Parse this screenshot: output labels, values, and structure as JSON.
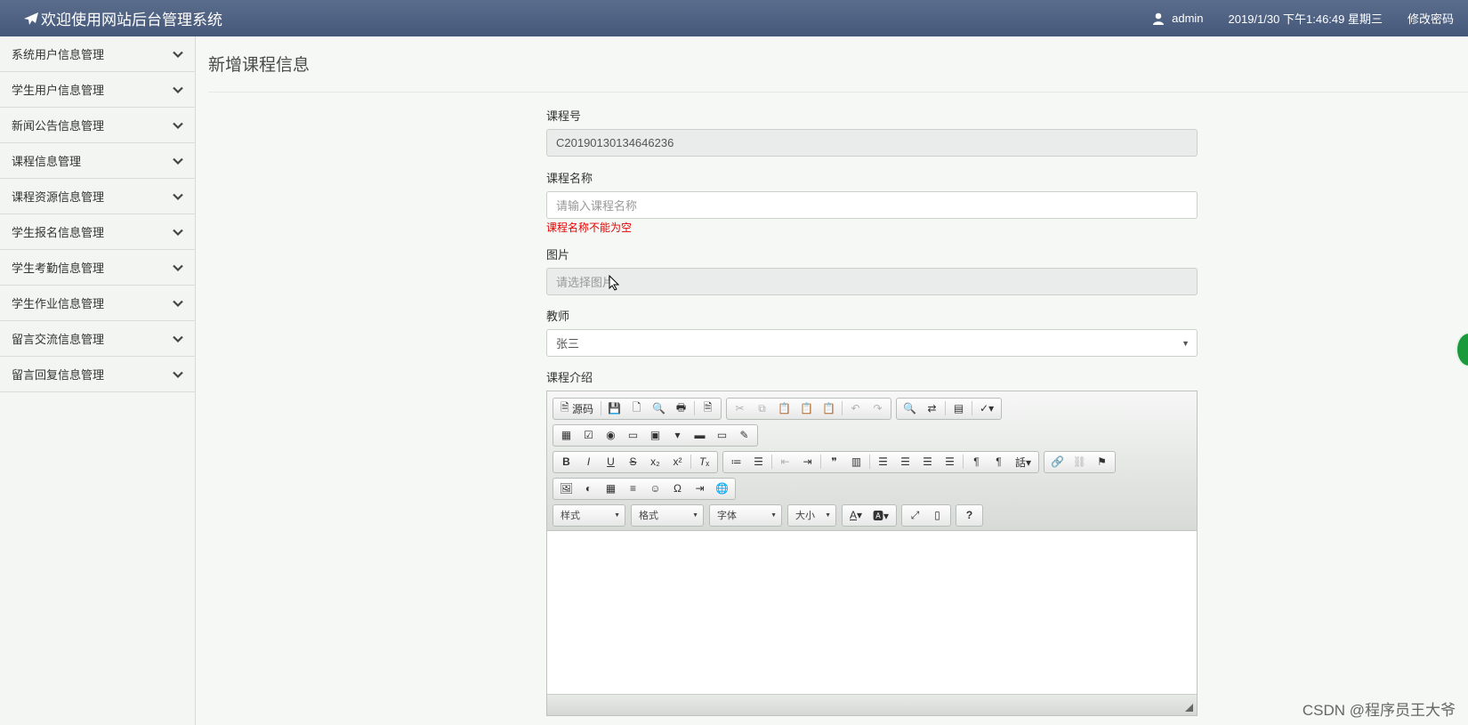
{
  "header": {
    "title": "欢迎使用网站后台管理系统",
    "user": "admin",
    "datetime": "2019/1/30 下午1:46:49 星期三",
    "change_password": "修改密码"
  },
  "sidebar": {
    "items": [
      {
        "label": "系统用户信息管理"
      },
      {
        "label": "学生用户信息管理"
      },
      {
        "label": "新闻公告信息管理"
      },
      {
        "label": "课程信息管理"
      },
      {
        "label": "课程资源信息管理"
      },
      {
        "label": "学生报名信息管理"
      },
      {
        "label": "学生考勤信息管理"
      },
      {
        "label": "学生作业信息管理"
      },
      {
        "label": "留言交流信息管理"
      },
      {
        "label": "留言回复信息管理"
      }
    ]
  },
  "main": {
    "title": "新增课程信息",
    "form": {
      "course_no": {
        "label": "课程号",
        "value": "C20190130134646236"
      },
      "course_name": {
        "label": "课程名称",
        "placeholder": "请输入课程名称",
        "error": "课程名称不能为空"
      },
      "image": {
        "label": "图片",
        "placeholder": "请选择图片"
      },
      "teacher": {
        "label": "教师",
        "value": "张三"
      },
      "intro": {
        "label": "课程介绍",
        "toolbar": {
          "source_label": "源码",
          "style_label": "样式",
          "format_label": "格式",
          "font_label": "字体",
          "size_label": "大小",
          "help_label": "?"
        }
      }
    }
  },
  "watermark": "CSDN @程序员王大爷",
  "colors": {
    "topbar": "#4f6283",
    "error": "#e60000",
    "sidebar_bg": "#f3f5f3"
  }
}
